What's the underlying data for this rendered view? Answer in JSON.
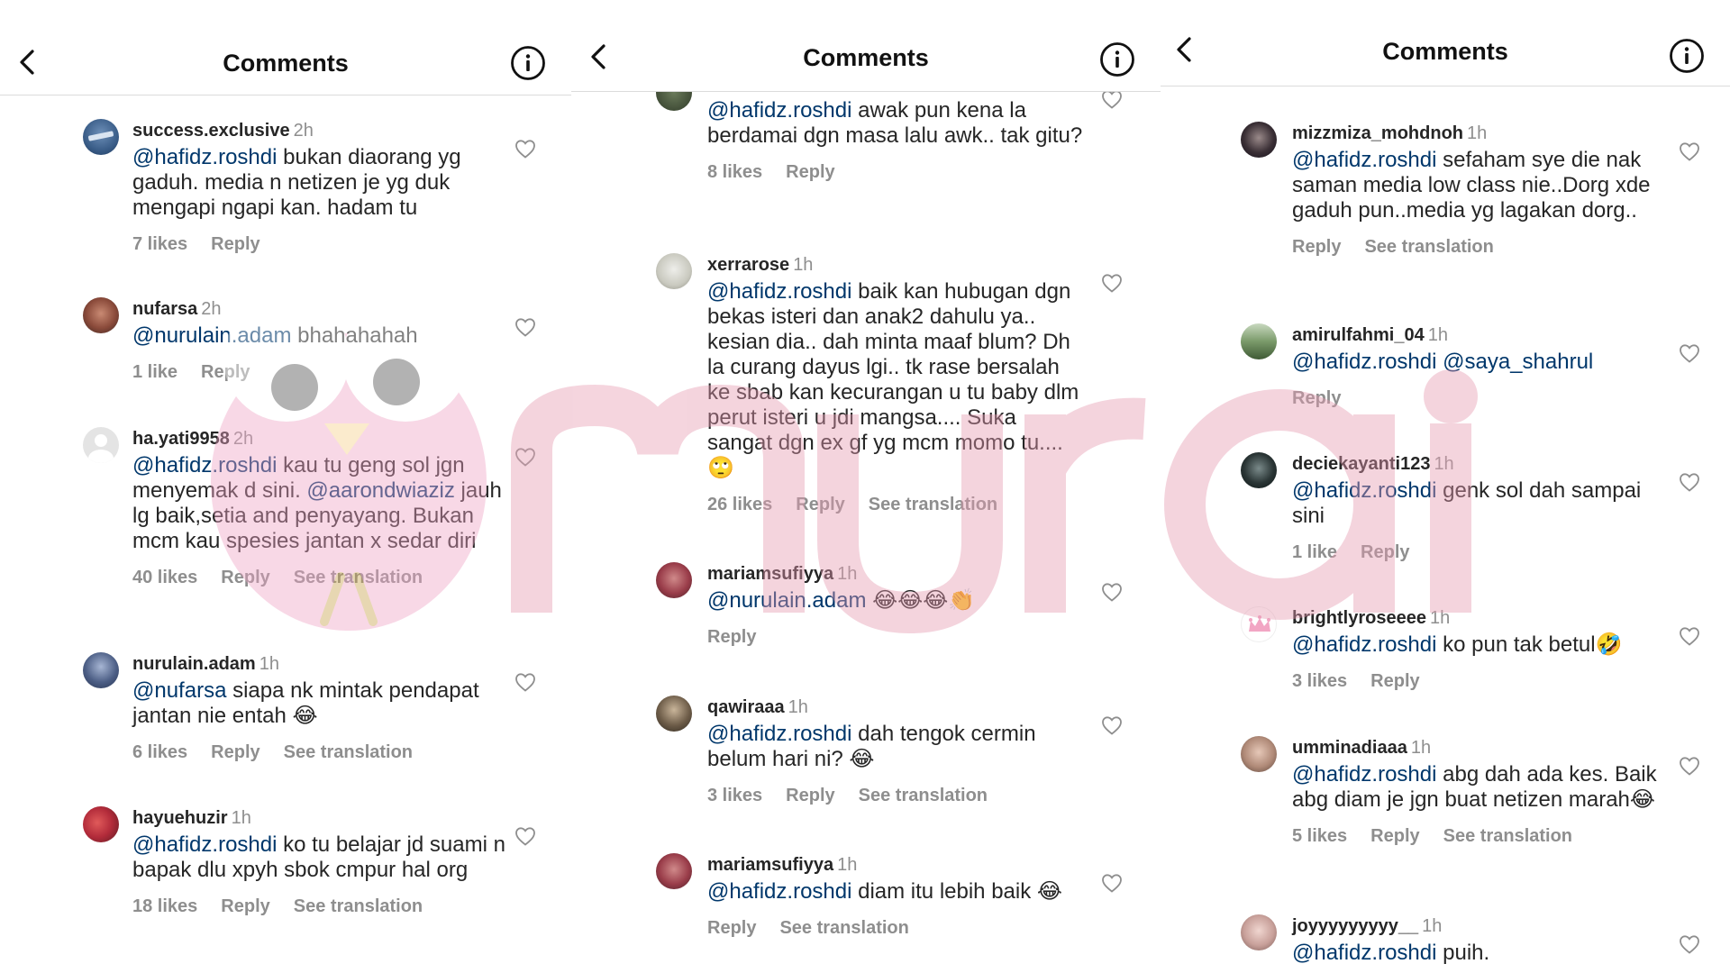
{
  "panels": [
    {
      "header": {
        "title": "Comments"
      },
      "comments": [
        {
          "user": "success.exclusive",
          "time": "2h",
          "mention": "@hafidz.roshdi",
          "text": " bukan diaorang yg gaduh. media n netizen je yg duk mengapi ngapi kan. hadam tu",
          "likes": "7 likes",
          "reply": "Reply",
          "translation": ""
        },
        {
          "user": "nufarsa",
          "time": "2h",
          "mention": "@nurulain.adam",
          "text": " bhahahahah",
          "likes": "1 like",
          "reply": "Reply",
          "translation": ""
        },
        {
          "user": "ha.yati9958",
          "time": "2h",
          "mention": "@hafidz.roshdi",
          "text": " kau tu geng sol jgn menyemak d sini. ",
          "mention2": "@aarondwiaziz",
          "text2": " jauh lg baik,setia and penyayang. Bukan mcm kau spesies jantan x sedar diri",
          "likes": "40 likes",
          "reply": "Reply",
          "translation": "See translation"
        },
        {
          "user": "nurulain.adam",
          "time": "1h",
          "mention": "@nufarsa",
          "text": " siapa nk mintak pendapat jantan nie entah 😂",
          "likes": "6 likes",
          "reply": "Reply",
          "translation": "See translation"
        },
        {
          "user": "hayuehuzir",
          "time": "1h",
          "mention": "@hafidz.roshdi",
          "text": " ko tu belajar jd suami n bapak dlu xpyh sbok cmpur hal org",
          "likes": "18 likes",
          "reply": "Reply",
          "translation": "See translation"
        }
      ]
    },
    {
      "header": {
        "title": "Comments"
      },
      "comments": [
        {
          "user": "",
          "time": "",
          "mention": "@hafidz.roshdi",
          "text": " awak pun kena la berdamai dgn masa lalu awk.. tak gitu?",
          "likes": "8 likes",
          "reply": "Reply",
          "translation": ""
        },
        {
          "user": "xerrarose",
          "time": "1h",
          "mention": "@hafidz.roshdi",
          "text": " baik kan hubugan dgn bekas isteri dan anak2 dahulu ya.. kesian dia.. dah minta maaf blum? Dh la curang dayus lgi.. tk rase bersalah ke sbab kan kecurangan u tu baby dlm perut isteri u jdi mangsa.... Suka sangat dgn ex gf yg mcm momo tu.... 🙄",
          "likes": "26 likes",
          "reply": "Reply",
          "translation": "See translation"
        },
        {
          "user": "mariamsufiyya",
          "time": "1h",
          "mention": "@nurulain.adam",
          "text": " 😂😂😂👏",
          "likes": "",
          "reply": "Reply",
          "translation": ""
        },
        {
          "user": "qawiraaa",
          "time": "1h",
          "mention": "@hafidz.roshdi",
          "text": " dah tengok cermin belum hari ni? 😂",
          "likes": "3 likes",
          "reply": "Reply",
          "translation": "See translation"
        },
        {
          "user": "mariamsufiyya",
          "time": "1h",
          "mention": "@hafidz.roshdi",
          "text": " diam itu lebih baik 😂",
          "likes": "",
          "reply": "Reply",
          "translation": "See translation"
        }
      ]
    },
    {
      "header": {
        "title": "Comments"
      },
      "comments": [
        {
          "user": "mizzmiza_mohdnoh",
          "time": "1h",
          "mention": "@hafidz.roshdi",
          "text": " sefaham sye die nak saman media low class nie..Dorg xde gaduh pun..media yg lagakan dorg..",
          "likes": "",
          "reply": "Reply",
          "translation": "See translation"
        },
        {
          "user": "amirulfahmi_04",
          "time": "1h",
          "mention": "@hafidz.roshdi",
          "text": " ",
          "mention2": "@saya_shahrul",
          "text2": "",
          "likes": "",
          "reply": "Reply",
          "translation": ""
        },
        {
          "user": "deciekayanti123",
          "time": "1h",
          "mention": "@hafidz.roshdi",
          "text": " genk sol dah sampai sini",
          "likes": "1 like",
          "reply": "Reply",
          "translation": ""
        },
        {
          "user": "brightlyroseeee",
          "time": "1h",
          "mention": "@hafidz.roshdi",
          "text": " ko pun tak betul🤣",
          "likes": "3 likes",
          "reply": "Reply",
          "translation": ""
        },
        {
          "user": "umminadiaaa",
          "time": "1h",
          "mention": "@hafidz.roshdi",
          "text": " abg dah ada kes. Baik abg diam je jgn buat netizen marah😂",
          "likes": "5 likes",
          "reply": "Reply",
          "translation": "See translation"
        },
        {
          "user": "joyyyyyyyyy__",
          "time": "1h",
          "mention": "@hafidz.roshdi",
          "text": " puih.",
          "likes": "",
          "reply": "",
          "translation": ""
        }
      ]
    }
  ],
  "watermark": {
    "text": "murai",
    "color": "#e9a6b6"
  },
  "colors": {
    "mention": "#00376b",
    "muted": "#8e8e8e",
    "text": "#262626"
  }
}
